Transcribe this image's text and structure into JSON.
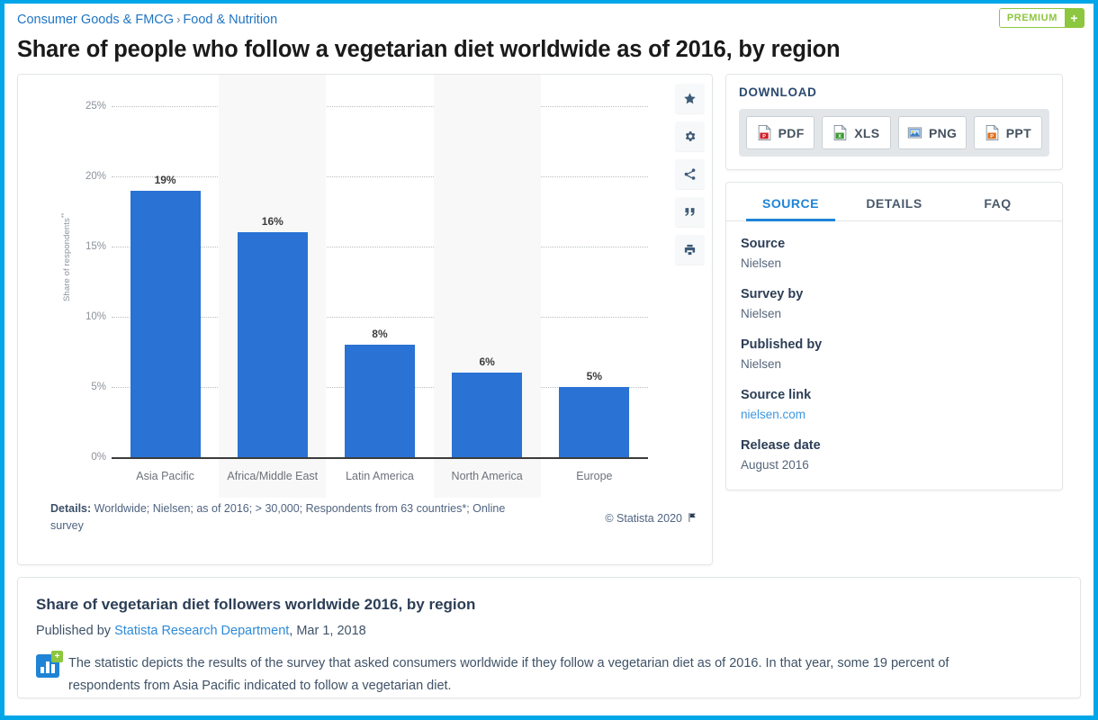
{
  "header": {
    "breadcrumb": [
      "Consumer Goods & FMCG",
      "Food & Nutrition"
    ],
    "separator": "›",
    "title": "Share of people who follow a vegetarian diet worldwide as of 2016, by region",
    "premium_label": "PREMIUM",
    "premium_plus": "+"
  },
  "chart_data": {
    "type": "bar",
    "title": "Share of people who follow a vegetarian diet worldwide as of 2016, by region",
    "categories": [
      "Asia Pacific",
      "Africa/Middle East",
      "Latin America",
      "North America",
      "Europe"
    ],
    "values": [
      19,
      16,
      8,
      6,
      5
    ],
    "value_labels": [
      "19%",
      "16%",
      "8%",
      "6%",
      "5%"
    ],
    "xlabel": "",
    "ylabel": "Share of respondents",
    "ylabel_superscript": "**",
    "ylim": [
      0,
      25
    ],
    "yticks": [
      0,
      5,
      10,
      15,
      20,
      25
    ],
    "ytick_labels": [
      "0%",
      "5%",
      "10%",
      "15%",
      "20%",
      "25%"
    ],
    "grid": true,
    "legend": "none",
    "bar_color": "#2a72d4",
    "band_color": "#f8f8f8"
  },
  "chart_tools": [
    {
      "name": "favorite",
      "icon": "star-icon"
    },
    {
      "name": "settings",
      "icon": "gear-icon"
    },
    {
      "name": "share",
      "icon": "share-icon"
    },
    {
      "name": "cite",
      "icon": "quote-icon"
    },
    {
      "name": "print",
      "icon": "print-icon"
    }
  ],
  "chart_footer": {
    "details_label": "Details:",
    "details_text": "Worldwide; Nielsen; as of 2016; > 30,000; Respondents from 63 countries*; Online survey",
    "copyright": "© Statista 2020"
  },
  "download": {
    "title": "DOWNLOAD",
    "buttons": [
      {
        "label": "PDF",
        "color": "#cf2027"
      },
      {
        "label": "XLS",
        "color": "#3f9b35"
      },
      {
        "label": "PNG",
        "color": "#3a77bd"
      },
      {
        "label": "PPT",
        "color": "#e07020"
      }
    ]
  },
  "source_panel": {
    "tabs": [
      {
        "label": "SOURCE",
        "active": true
      },
      {
        "label": "DETAILS",
        "active": false
      },
      {
        "label": "FAQ",
        "active": false
      }
    ],
    "items": [
      {
        "key": "Source",
        "value": "Nielsen",
        "is_link": false
      },
      {
        "key": "Survey by",
        "value": "Nielsen",
        "is_link": false
      },
      {
        "key": "Published by",
        "value": "Nielsen",
        "is_link": false
      },
      {
        "key": "Source link",
        "value": "nielsen.com",
        "is_link": true
      },
      {
        "key": "Release date",
        "value": "August 2016",
        "is_link": false
      }
    ]
  },
  "bottom": {
    "title": "Share of vegetarian diet followers worldwide 2016, by region",
    "published_prefix": "Published by ",
    "published_link": "Statista Research Department",
    "published_suffix": ", Mar 1, 2018",
    "badge_plus": "+",
    "description": "The statistic depicts the results of the survey that asked consumers worldwide if they follow a vegetarian diet as of 2016. In that year, some 19 percent of respondents from Asia Pacific indicated to follow a vegetarian diet."
  },
  "colors": {
    "page_border": "#00a6e8",
    "accent_blue": "#1f84d6",
    "bar_blue": "#2a72d4",
    "premium_green": "#8dc63f"
  }
}
